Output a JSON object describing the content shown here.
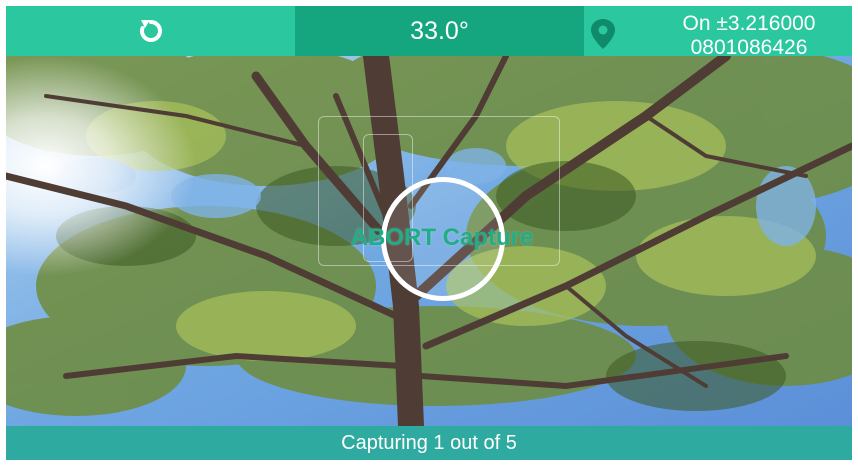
{
  "topbar": {
    "reset_icon": "refresh-icon",
    "angle": "33.0°",
    "location_icon": "map-pin-icon",
    "gps_line1": "On ±3.216000",
    "gps_line2": "0801086426"
  },
  "capture": {
    "abort_label": "ABORT Capture"
  },
  "status": {
    "text": "Capturing 1 out of 5"
  },
  "colors": {
    "bar_accent": "#2bc8a0",
    "bar_accent_dark": "#15a67f",
    "abort_text": "#1fae86",
    "sky": "#7fb3e6"
  }
}
